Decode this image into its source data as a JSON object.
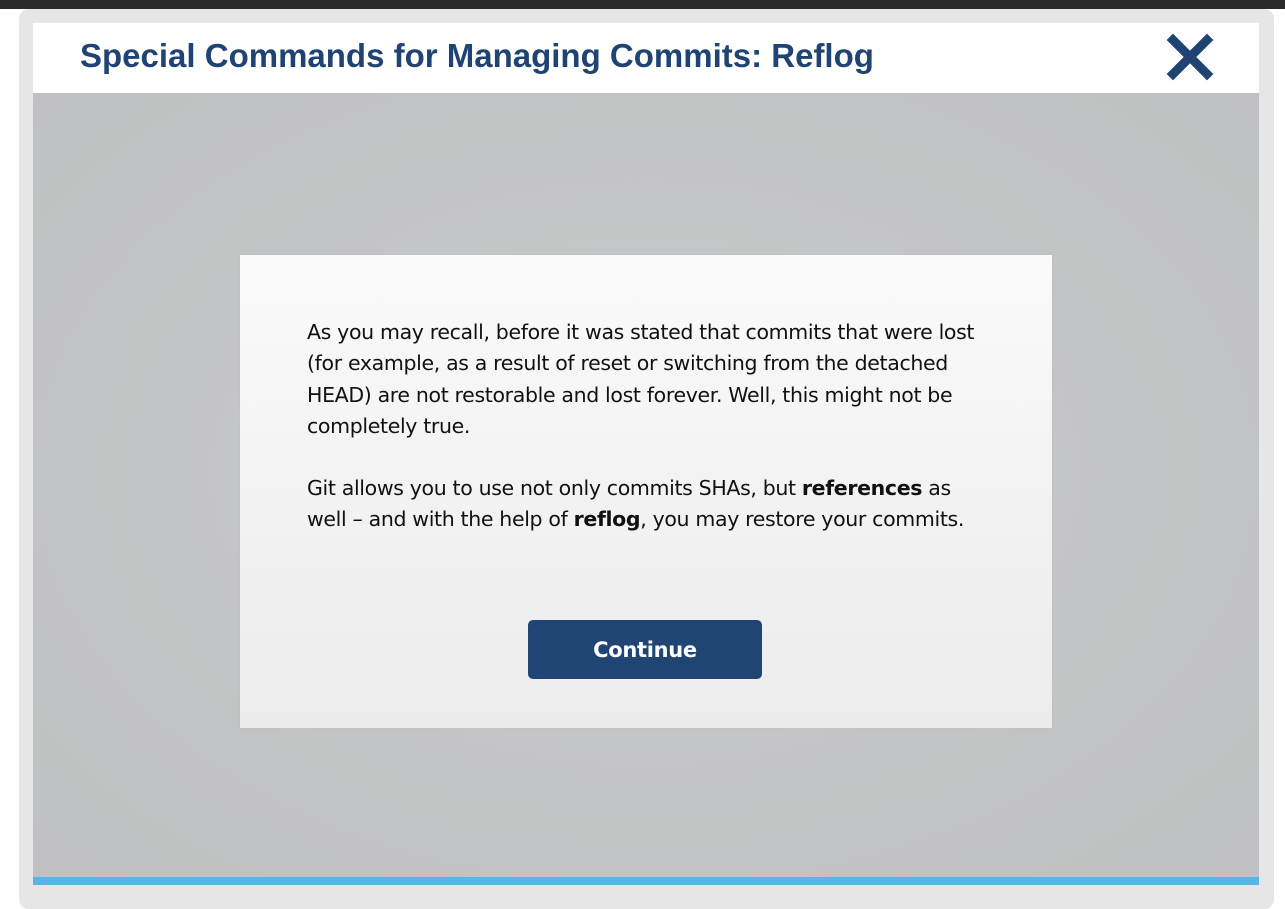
{
  "header": {
    "title": "Special Commands for Managing Commits: Reflog",
    "close_icon": "close-x-icon",
    "title_color": "#1f4372"
  },
  "dialog": {
    "paragraph1": "As you may recall, before it was stated that commits that were lost (for example, as a result of reset or switching from the detached HEAD) are not restorable and lost forever. Well, this might not be completely true.",
    "paragraph2": {
      "part1": "Git allows you to use not only commits SHAs, but ",
      "bold1": "references",
      "part2": " as well – and with the help of ",
      "bold2": "reflog",
      "part3": ", you may restore your commits."
    },
    "continue_label": "Continue",
    "button_color": "#204575"
  },
  "accent_color": "#5ab4e5"
}
